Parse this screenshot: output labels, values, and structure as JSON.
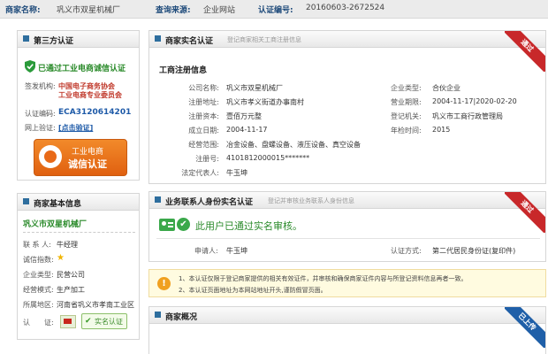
{
  "topbar": {
    "name_label": "商家名称:",
    "name_value": "巩义市双星机械厂",
    "source_label": "查询来源:",
    "source_value": "企业网站",
    "cert_label": "认证编号:",
    "cert_value": "20160603-2672524"
  },
  "third_party": {
    "title": "第三方认证",
    "passed_text": "已通过工业电商诚信认证",
    "issuer_label": "签发机构:",
    "issuer_line1": "中国电子商务协会",
    "issuer_line2": "工业电商专业委员会",
    "cert_no_label": "认证编码:",
    "cert_no_value": "ECA3120614201",
    "verify_label": "网上验证:",
    "verify_link": "[点击验证]",
    "badge_line1": "工业电商",
    "badge_line2": "诚信认证"
  },
  "basic_info": {
    "title": "商家基本信息",
    "company": "巩义市双星机械厂",
    "contact_label": "联 系 人:",
    "contact_value": "牛经理",
    "credit_label": "诚信指数:",
    "type_label": "企业类型:",
    "type_value": "民营公司",
    "mode_label": "经营模式:",
    "mode_value": "生产加工",
    "region_label": "所属地区:",
    "region_value": "河南省巩义市孝南工业区",
    "cert_label": "认　　证:",
    "realname_badge": "实名认证"
  },
  "realname": {
    "title": "商家实名认证",
    "subtitle": "登记商家相关工商注册信息",
    "ribbon": "通过",
    "section": "工商注册信息",
    "left": [
      {
        "k": "公司名称:",
        "v": "巩义市双星机械厂"
      },
      {
        "k": "注册地址:",
        "v": "巩义市孝义街道办事南村"
      },
      {
        "k": "注册资本:",
        "v": "壹佰万元整"
      },
      {
        "k": "成立日期:",
        "v": "2004-11-17"
      },
      {
        "k": "经营范围:",
        "v": "冶金设备、盘螺设备、液压设备、真空设备"
      },
      {
        "k": "注册号:",
        "v": "4101812000015*******"
      },
      {
        "k": "法定代表人:",
        "v": "牛玉坤"
      }
    ],
    "right": [
      {
        "k": "企业类型:",
        "v": "合伙企业"
      },
      {
        "k": "营业期限:",
        "v": "2004-11-17|2020-02-20"
      },
      {
        "k": "登记机关:",
        "v": "巩义市工商行政管理局"
      },
      {
        "k": "年检时间:",
        "v": "2015"
      }
    ]
  },
  "business_contact": {
    "title": "业务联系人身份实名认证",
    "subtitle": "登记并审核业务联系人身份信息",
    "ribbon": "通过",
    "status_text": "此用户已通过实名审核。",
    "applicant_label": "申请人:",
    "applicant_value": "牛玉坤",
    "method_label": "认证方式:",
    "method_value": "第二代居民身份证(复印件)"
  },
  "notice": {
    "line1": "1、本认证仅限于登记商家提供的相关有效证件，并审核和确保商家证件内容与所登记资料信息再者一致。",
    "line2": "2、本认证页面地址为本网站地址开头,谨防假冒页面。"
  },
  "overview": {
    "title": "商家概况",
    "ribbon": "已上传"
  },
  "colors": {
    "brand_blue": "#2e6e9e",
    "pass_red": "#c8282a",
    "uploaded_blue": "#1f5fa8",
    "pass_green": "#2a8a2a"
  }
}
